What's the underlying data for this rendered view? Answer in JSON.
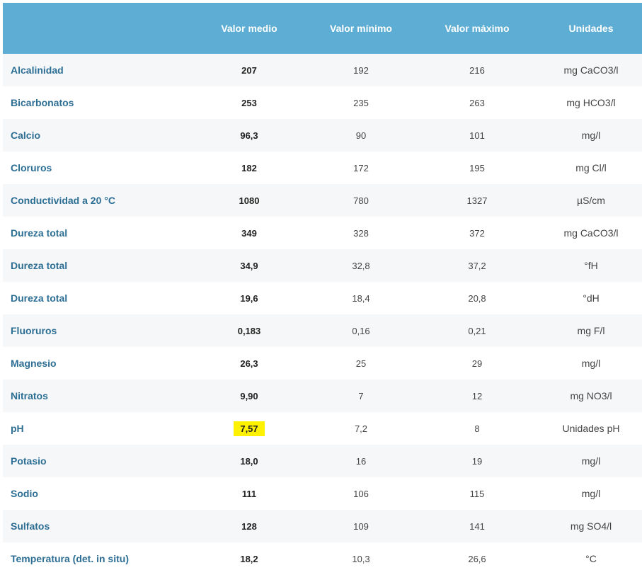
{
  "table": {
    "columns": [
      "",
      "Valor medio",
      "Valor mínimo",
      "Valor máximo",
      "Unidades"
    ],
    "rows": [
      {
        "param": "Alcalinidad",
        "avg": "207",
        "min": "192",
        "max": "216",
        "unit": "mg CaCO3/l"
      },
      {
        "param": "Bicarbonatos",
        "avg": "253",
        "min": "235",
        "max": "263",
        "unit": "mg HCO3/l"
      },
      {
        "param": "Calcio",
        "avg": "96,3",
        "min": "90",
        "max": "101",
        "unit": "mg/l"
      },
      {
        "param": "Cloruros",
        "avg": "182",
        "min": "172",
        "max": "195",
        "unit": "mg Cl/l"
      },
      {
        "param": "Conductividad a 20 °C",
        "avg": "1080",
        "min": "780",
        "max": "1327",
        "unit": "µS/cm"
      },
      {
        "param": "Dureza total",
        "avg": "349",
        "min": "328",
        "max": "372",
        "unit": "mg CaCO3/l"
      },
      {
        "param": "Dureza total",
        "avg": "34,9",
        "min": "32,8",
        "max": "37,2",
        "unit": "°fH"
      },
      {
        "param": "Dureza total",
        "avg": "19,6",
        "min": "18,4",
        "max": "20,8",
        "unit": "°dH"
      },
      {
        "param": "Fluoruros",
        "avg": "0,183",
        "min": "0,16",
        "max": "0,21",
        "unit": "mg F/l"
      },
      {
        "param": "Magnesio",
        "avg": "26,3",
        "min": "25",
        "max": "29",
        "unit": "mg/l"
      },
      {
        "param": "Nitratos",
        "avg": "9,90",
        "min": "7",
        "max": "12",
        "unit": "mg NO3/l"
      },
      {
        "param": "pH",
        "avg": "7,57",
        "min": "7,2",
        "max": "8",
        "unit": "Unidades pH",
        "highlight": true
      },
      {
        "param": "Potasio",
        "avg": "18,0",
        "min": "16",
        "max": "19",
        "unit": "mg/l"
      },
      {
        "param": "Sodio",
        "avg": "111",
        "min": "106",
        "max": "115",
        "unit": "mg/l"
      },
      {
        "param": "Sulfatos",
        "avg": "128",
        "min": "109",
        "max": "141",
        "unit": "mg SO4/l"
      },
      {
        "param": "Temperatura (det. in situ)",
        "avg": "18,2",
        "min": "10,3",
        "max": "26,6",
        "unit": "°C"
      }
    ]
  },
  "colors": {
    "header_bg": "#5dadd4",
    "param_text": "#2c6e94",
    "highlight": "#fff200"
  }
}
